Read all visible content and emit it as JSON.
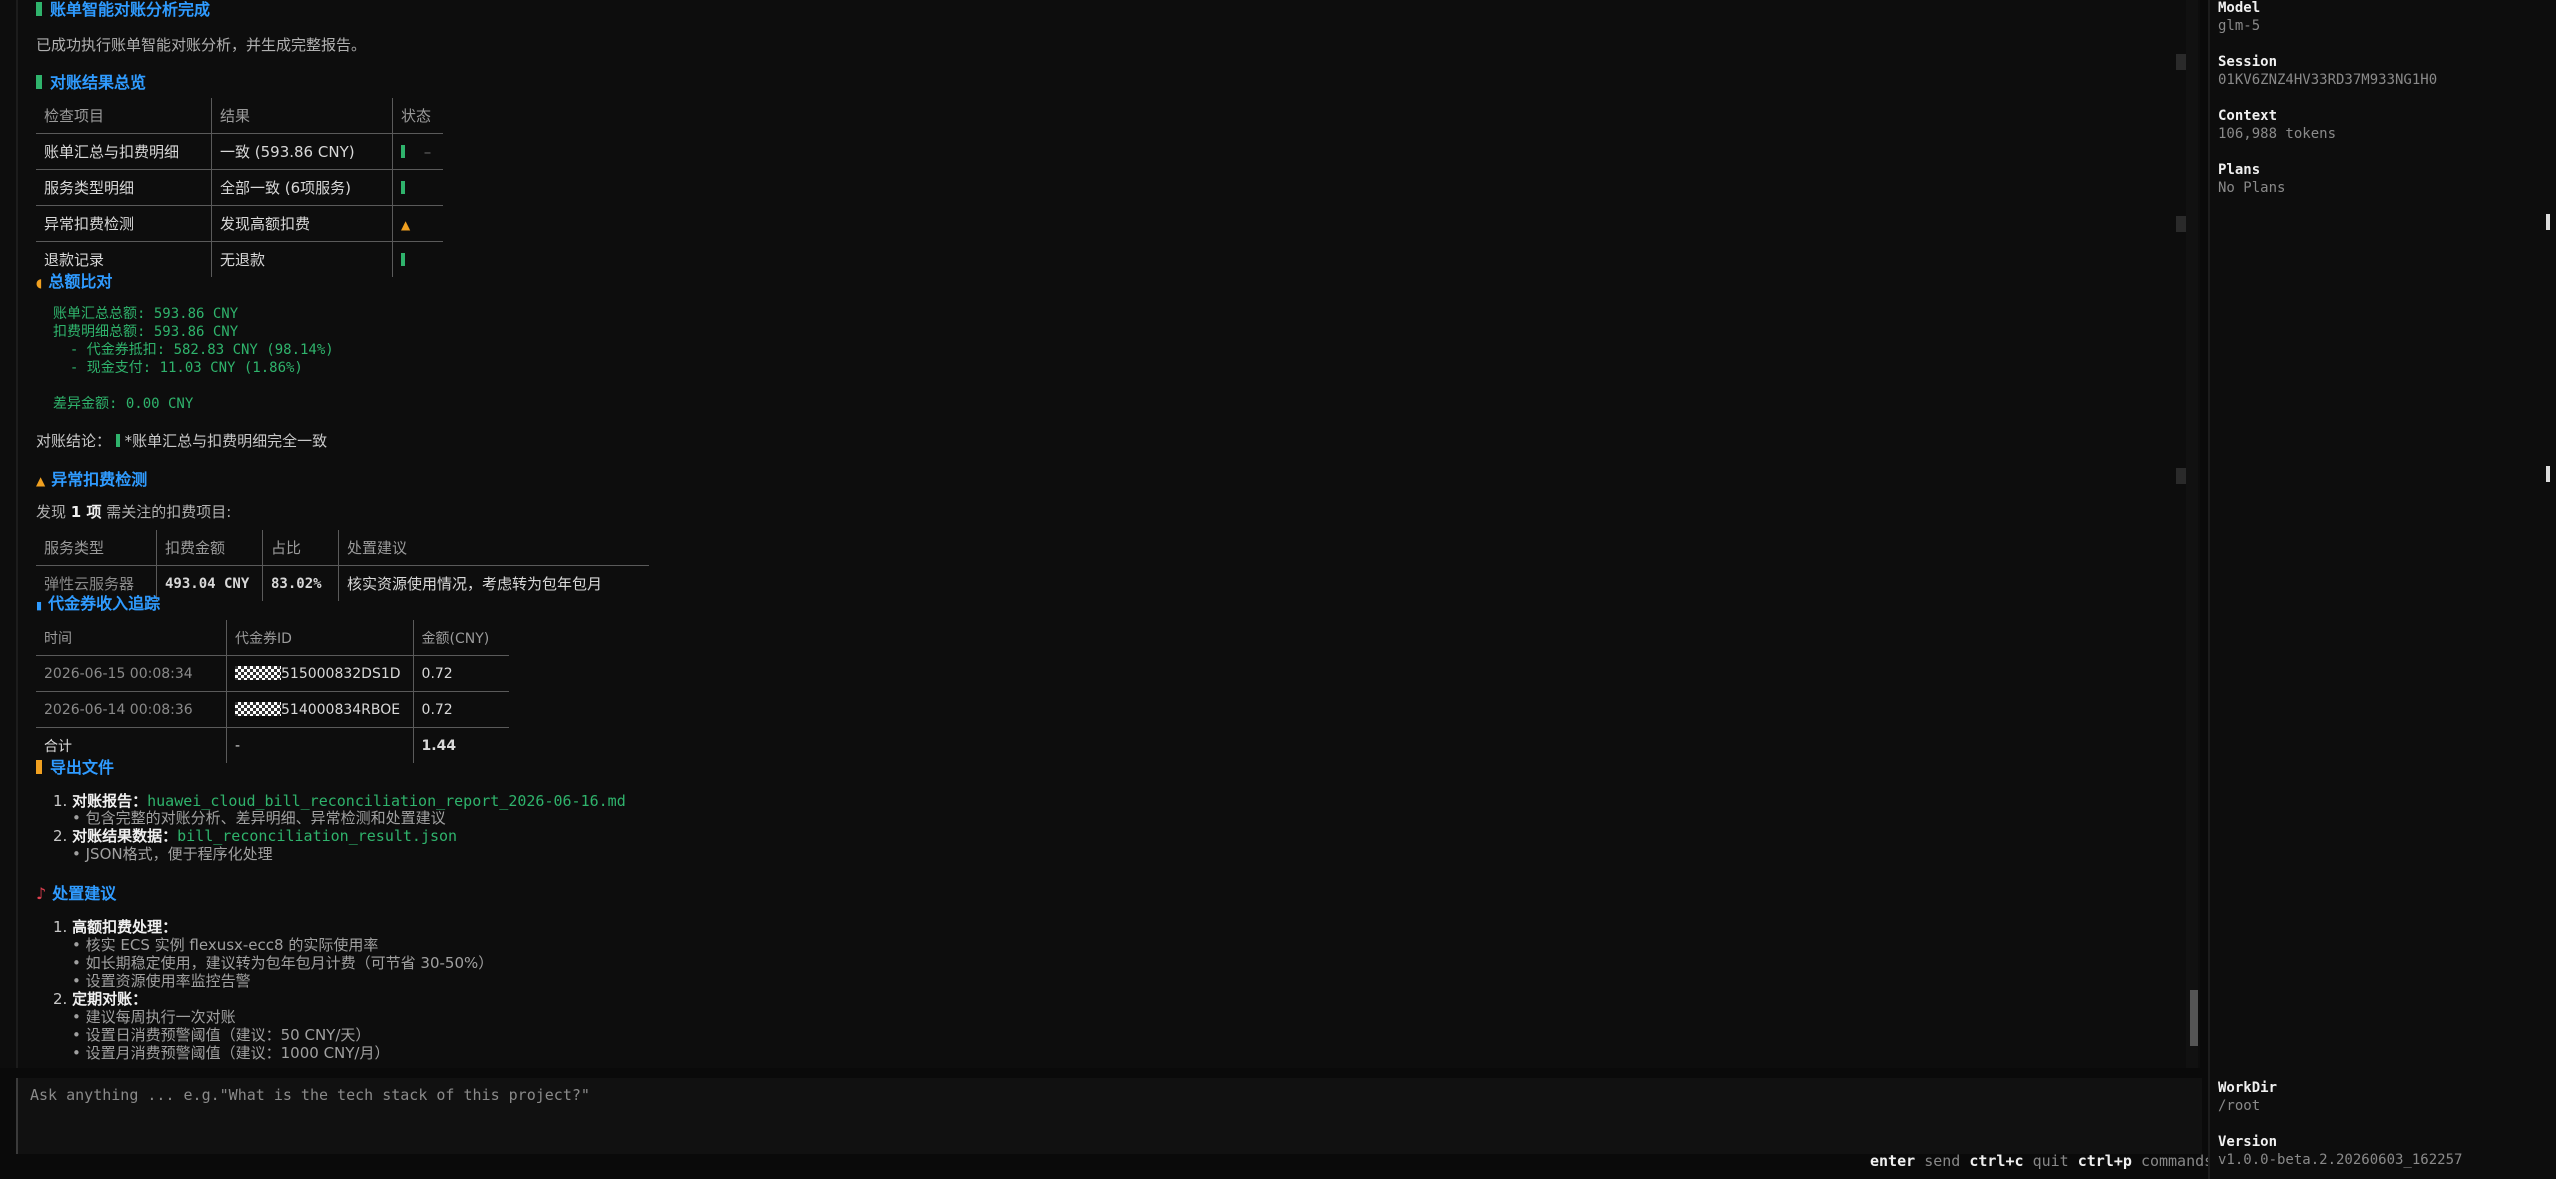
{
  "main": {
    "header": {
      "title": "账单智能对账分析完成"
    },
    "intro": "已成功执行账单智能对账分析，并生成完整报告。",
    "overview": {
      "title": "对账结果总览",
      "columns": [
        "检查项目",
        "结果",
        "状态"
      ],
      "rows": [
        {
          "item": "账单汇总与扣费明细",
          "result": "一致 (593.86 CNY)",
          "status": "ok"
        },
        {
          "item": "服务类型明细",
          "result": "全部一致 (6项服务)",
          "status": "ok"
        },
        {
          "item": "异常扣费检测",
          "result": "发现高额扣费",
          "status": "warn"
        },
        {
          "item": "退款记录",
          "result": "无退款",
          "status": "ok"
        }
      ],
      "trailing_dash": "–"
    },
    "amount": {
      "title": "总额比对",
      "lines": [
        "账单汇总总额: 593.86 CNY",
        "扣费明细总额: 593.86 CNY",
        "  - 代金券抵扣: 582.83 CNY (98.14%)",
        "  - 现金支付: 11.03 CNY (1.86%)",
        "差异金额: 0.00 CNY"
      ],
      "conclusion_label": "对账结论：",
      "conclusion_text": "*账单汇总与扣费明细完全一致"
    },
    "anomaly": {
      "title": "异常扣费检测",
      "found_prefix": "发现",
      "found_count": "1 项",
      "found_suffix": "需关注的扣费项目:",
      "columns": [
        "服务类型",
        "扣费金额",
        "占比",
        "处置建议"
      ],
      "rows": [
        {
          "service": "弹性云服务器",
          "amount": "493.04 CNY",
          "ratio": "83.02%",
          "advice": "核实资源使用情况，考虑转为包年包月"
        }
      ]
    },
    "voucher": {
      "title": "代金券收入追踪",
      "columns": [
        "时间",
        "代金券ID",
        "金额(CNY)"
      ],
      "rows": [
        {
          "time": "2026-06-15 00:08:34",
          "id": "515000832DS1D",
          "amount": "0.72"
        },
        {
          "time": "2026-06-14 00:08:36",
          "id": "514000834RBOE",
          "amount": "0.72"
        },
        {
          "time": "合计",
          "id": "-",
          "amount": "1.44"
        }
      ]
    },
    "export": {
      "title": "导出文件",
      "items": [
        {
          "num": "1.",
          "label": "对账报告：",
          "file": "huawei_cloud_bill_reconciliation_report_2026-06-16.md",
          "sub": "包含完整的对账分析、差异明细、异常检测和处置建议"
        },
        {
          "num": "2.",
          "label": "对账结果数据：",
          "file": "bill_reconciliation_result.json",
          "sub": "JSON格式，便于程序化处理"
        }
      ]
    },
    "advice": {
      "title": "处置建议",
      "groups": [
        {
          "num": "1.",
          "label": "高额扣费处理：",
          "items": [
            "核实 ECS 实例 flexusx-ecc8 的实际使用率",
            "如长期稳定使用，建议转为包年包月计费（可节省 30-50%）",
            "设置资源使用率监控告警"
          ]
        },
        {
          "num": "2.",
          "label": "定期对账：",
          "items": [
            "建议每周执行一次对账",
            "设置日消费预警阈值（建议：50 CNY/天）",
            "设置月消费预警阈值（建议：1000 CNY/月）"
          ]
        }
      ]
    }
  },
  "input": {
    "placeholder": "Ask anything ... e.g.\"What is the tech stack of this project?\""
  },
  "hints": [
    {
      "key": "enter",
      "action": "send"
    },
    {
      "key": "ctrl+c",
      "action": "quit"
    },
    {
      "key": "ctrl+p",
      "action": "commands"
    }
  ],
  "sidebar": {
    "model_label": "Model",
    "model_value": "glm-5",
    "session_label": "Session",
    "session_value": "01KV6ZNZ4HV33RD37M933NG1H0",
    "context_label": "Context",
    "context_value": "106,988 tokens",
    "plans_label": "Plans",
    "plans_value": "No Plans",
    "workdir_label": "WorkDir",
    "workdir_value": "/root",
    "version_label": "Version",
    "version_value": "v1.0.0-beta.2.20260603_162257"
  },
  "colors": {
    "accent": "#2f9bff",
    "ok": "#2fb36c",
    "warn": "#f0a020",
    "bg": "#0a0a0a"
  }
}
